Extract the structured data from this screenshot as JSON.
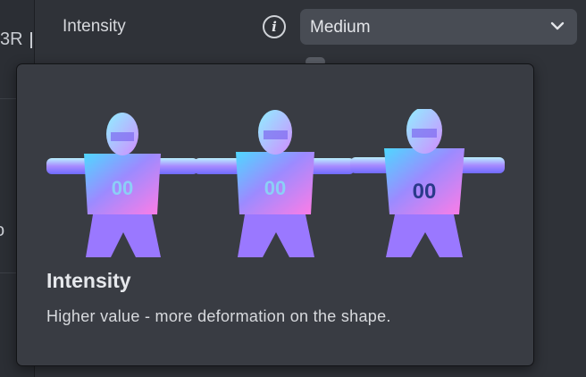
{
  "side_panel": {
    "top_text": "3R",
    "mid_text": "o"
  },
  "intensity_row": {
    "label": "Intensity",
    "info_icon": "info-icon",
    "dropdown": {
      "value": "Medium",
      "icon": "chevron-down-icon"
    }
  },
  "tooltip": {
    "image": {
      "description_icon": "character-deformation-preview",
      "variants": 3,
      "colors": [
        "#9b6bff",
        "#4fd7ff",
        "#ff7ce6",
        "#b9f0ff"
      ]
    },
    "title": "Intensity",
    "description": "Higher value - more deformation on the shape."
  }
}
